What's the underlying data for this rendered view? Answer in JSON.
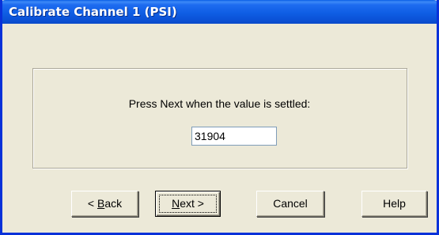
{
  "window": {
    "title": "Calibrate Channel 1 (PSI)"
  },
  "dialog": {
    "prompt": "Press Next when the value is settled:",
    "value": "31904"
  },
  "buttons": {
    "back": {
      "prefix": "< ",
      "accel": "B",
      "rest": "ack"
    },
    "next": {
      "accel": "N",
      "rest": "ext >"
    },
    "cancel": "Cancel",
    "help": "Help"
  },
  "colors": {
    "titlebar": "#0a5ee6",
    "window_border": "#0831d9",
    "face": "#ece9d8",
    "field_border": "#7f9db9"
  }
}
